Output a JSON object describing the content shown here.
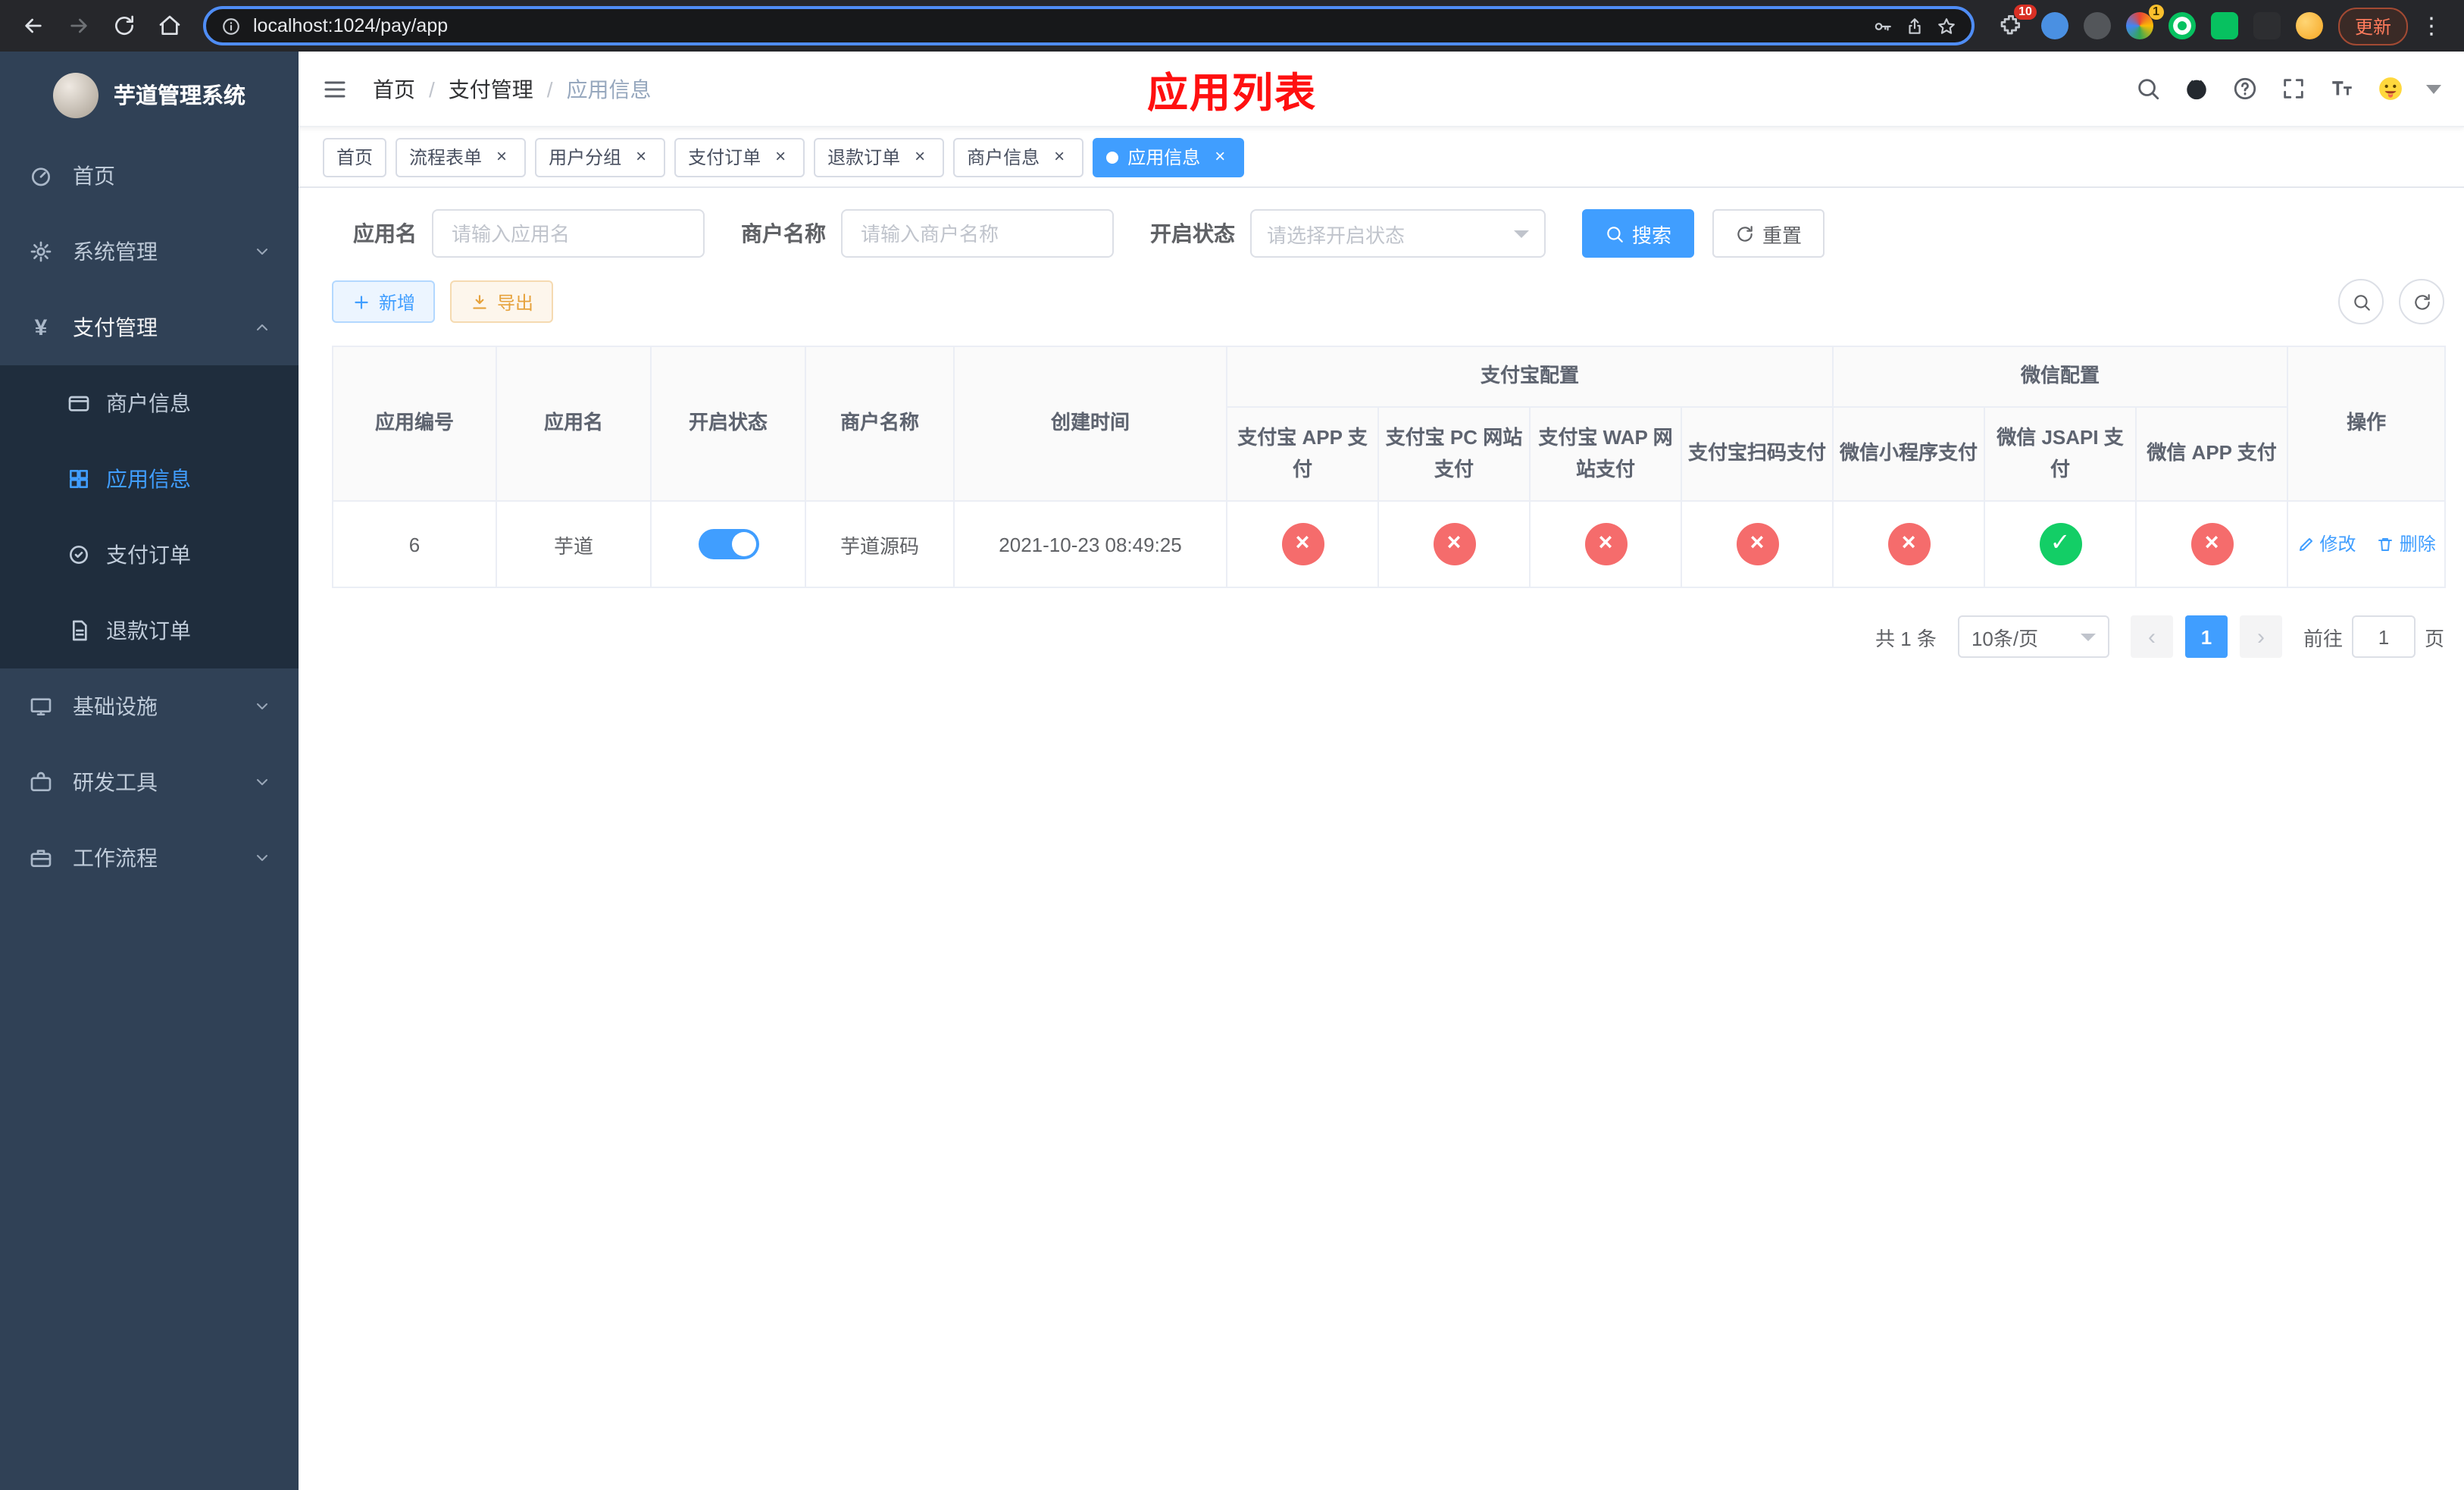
{
  "colors": {
    "accent": "#409eff",
    "danger": "#f56c6c",
    "success": "#13ce66",
    "warning": "#e6a23c",
    "page_title_red": "#ff1010"
  },
  "ui": {
    "fail_glyph": "×",
    "success_glyph": "✓",
    "prev_glyph": "‹",
    "next_glyph": "›",
    "dots_glyph": "⋮"
  },
  "browser": {
    "url": "localhost:1024/pay/app",
    "update_label": "更新",
    "ext_badge_puzzle": "10",
    "ext_badge_wheel": "1"
  },
  "sidebar": {
    "title": "芋道管理系统",
    "items": [
      {
        "label": "首页"
      },
      {
        "label": "系统管理"
      },
      {
        "label": "支付管理"
      },
      {
        "label": "基础设施"
      },
      {
        "label": "研发工具"
      },
      {
        "label": "工作流程"
      }
    ],
    "submenu": [
      {
        "label": "商户信息"
      },
      {
        "label": "应用信息"
      },
      {
        "label": "支付订单"
      },
      {
        "label": "退款订单"
      }
    ]
  },
  "navbar": {
    "breadcrumb": [
      "首页",
      "支付管理",
      "应用信息"
    ],
    "page_title": "应用列表"
  },
  "tabs": {
    "close": "×",
    "items": [
      {
        "label": "首页"
      },
      {
        "label": "流程表单"
      },
      {
        "label": "用户分组"
      },
      {
        "label": "支付订单"
      },
      {
        "label": "退款订单"
      },
      {
        "label": "商户信息"
      },
      {
        "label": "应用信息"
      }
    ]
  },
  "filters": {
    "app_name_label": "应用名",
    "app_name_placeholder": "请输入应用名",
    "merchant_label": "商户名称",
    "merchant_placeholder": "请输入商户名称",
    "status_label": "开启状态",
    "status_placeholder": "请选择开启状态",
    "search_label": "搜索",
    "reset_label": "重置"
  },
  "toolbar": {
    "add_label": "新增",
    "export_label": "导出"
  },
  "table": {
    "headers": {
      "app_id": "应用编号",
      "app_name": "应用名",
      "status": "开启状态",
      "merchant": "商户名称",
      "created": "创建时间",
      "alipay_group": "支付宝配置",
      "wechat_group": "微信配置",
      "alipay_app": "支付宝 APP 支付",
      "alipay_pc": "支付宝 PC 网站支付",
      "alipay_wap": "支付宝 WAP 网站支付",
      "alipay_qr": "支付宝扫码支付",
      "wx_mini": "微信小程序支付",
      "wx_jsapi": "微信 JSAPI 支付",
      "wx_app": "微信 APP 支付",
      "actions": "操作"
    },
    "row": {
      "app_id": "6",
      "app_name": "芋道",
      "enabled": true,
      "merchant": "芋道源码",
      "created": "2021-10-23 08:49:25",
      "statuses": [
        "fail",
        "fail",
        "fail",
        "fail",
        "fail",
        "success",
        "fail"
      ],
      "edit_label": "修改",
      "delete_label": "删除"
    }
  },
  "pagination": {
    "total": "共 1 条",
    "page_size": "10条/页",
    "page": "1",
    "goto_label": "前往",
    "goto_value": "1",
    "page_unit": "页"
  }
}
